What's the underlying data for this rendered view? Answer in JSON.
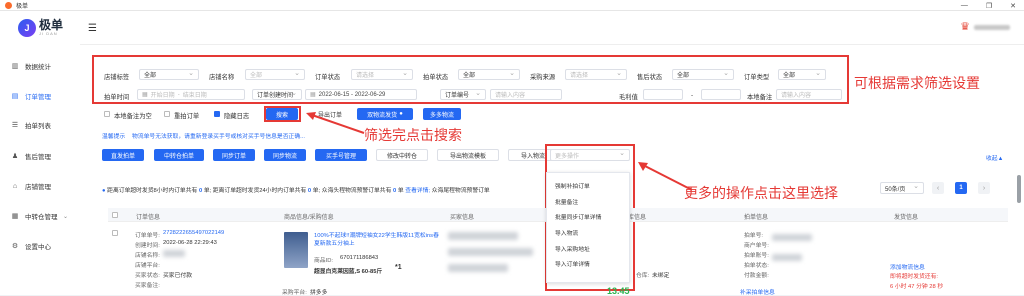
{
  "window": {
    "title": "极单"
  },
  "brand": {
    "name": "极单",
    "sub": "JI DAN"
  },
  "sidebar": {
    "items": [
      {
        "label": "数据统计",
        "icon": "bar-chart-icon"
      },
      {
        "label": "订单管理",
        "icon": "document-icon",
        "active": true
      },
      {
        "label": "拍单列表",
        "icon": "list-icon"
      },
      {
        "label": "售后管理",
        "icon": "service-icon"
      },
      {
        "label": "店铺管理",
        "icon": "shop-icon"
      },
      {
        "label": "中转仓管理",
        "icon": "warehouse-icon",
        "caret": "⌄"
      },
      {
        "label": "设置中心",
        "icon": "gear-icon"
      }
    ]
  },
  "filters": {
    "shop_tag": {
      "label": "店铺标签",
      "value": "全部"
    },
    "shop_name": {
      "label": "店铺名称",
      "value": "全部"
    },
    "order_status": {
      "label": "订单状态",
      "value": "请选择"
    },
    "purchase_status": {
      "label": "拍单状态",
      "value": "全部"
    },
    "purchase_source": {
      "label": "采购来源",
      "value": "请选择"
    },
    "aftersale_status": {
      "label": "售后状态",
      "value": "全部"
    },
    "order_type": {
      "label": "订单类型",
      "value": "全部"
    },
    "purchase_time": {
      "label": "拍单时间",
      "start_placeholder": "开始日期",
      "sep": "-",
      "end_placeholder": "结束日期"
    },
    "create_time": {
      "value": "订单创建时间",
      "range": "2022-06-15 - 2022-06-29"
    },
    "order_no": {
      "value": "订单编号",
      "placeholder": "请输入内容"
    },
    "gross_margin": {
      "label": "毛利值",
      "min_placeholder": "",
      "sep": "-",
      "max_placeholder": ""
    },
    "local_note": {
      "label": "本地备注",
      "placeholder": "请输入内容"
    }
  },
  "options": {
    "note_empty": "本地备注为空",
    "repeat_order": "重拍订单",
    "hide_log": "隐藏日志"
  },
  "actions": {
    "search": "搜索",
    "export": "导出订单",
    "dual_ship": "双物流发货",
    "dual_ship_badge": "●",
    "multi_logistics": "多多物流"
  },
  "notice": {
    "prefix": "温馨提示",
    "text": "物流单号无法获取，请重新登录买手号或核对买手号信息是否正确..."
  },
  "toolbar": {
    "direct_purchase": "直发拍单",
    "transit_purchase": "中转仓拍单",
    "sync_order": "同步订单",
    "sync_logistics": "同步物流",
    "buyer_manage": "买手号管理",
    "modify_transit": "修改中转仓",
    "export_template": "导出物流模板",
    "import_logistics": "导入物流",
    "more_ops": "更多操作",
    "collapse": "收起▲"
  },
  "more_menu": {
    "items": [
      "强制补拍订单",
      "批量备注",
      "批量同步订单详情",
      "导入物流",
      "导入采购地址",
      "导入订单详情"
    ]
  },
  "stats": {
    "text1": "距离订单超时发货8小时内订单共有",
    "c1": "0",
    "u1": "单;",
    "text2": "距离订单超时发货24小时内订单共有",
    "c2": "0",
    "u2": "单;",
    "text3": "众海头程物流预警订单共有",
    "c3": "0",
    "u3": "单",
    "link": "查看详情;",
    "text4": "众海尾程物流预警订单"
  },
  "pagination": {
    "page_size": "50条/页",
    "current": "1",
    "prev": "‹",
    "next": "›"
  },
  "table": {
    "headers": [
      "订单信息",
      "商品信息/采购信息",
      "买家信息",
      "仓库信息",
      "拍单信息",
      "发货信息"
    ]
  },
  "row": {
    "order_no_label": "订单单号:",
    "order_no": "2728222655497022149",
    "create_label": "创建时间:",
    "create_time": "2022-06-28 22:29:43",
    "shop_label": "店铺名称:",
    "shop_platform_label": "店铺平台:",
    "buyer_status_label": "买家状态:",
    "buyer_status": "买家已付款",
    "buyer_note_label": "买家备注:",
    "product_title": "100%不起球!!潮牌短袖女22学生韩版11宽松ins春夏新款五分袖上",
    "product_id_label": "商品ID:",
    "product_id": "670171186843",
    "product_spec": "超显白克莱因蓝,S 60-85斤",
    "product_qty": "*1",
    "purchase_platform_label": "采购平台:",
    "purchase_platform": "拼多多",
    "price": "13.45",
    "warehouse_label": "仓库:",
    "warehouse_value": "未绑定",
    "purchase_no_label": "拍单号:",
    "merchant_no_label": "商户单号:",
    "purchase_account_label": "拍单账号:",
    "purchase_status_label": "拍单状态:",
    "paid_label": "付款金额:",
    "add_logistics": "添加物流信息",
    "timeout_label": "即将超时发货还有:",
    "timeout_value": "6 小时 47 分钟 28 秒",
    "supplement": "补采拍单信息"
  },
  "annotations": {
    "filter_tip": "可根据需求筛选设置",
    "search_tip": "筛选完点击搜索",
    "more_tip": "更多的操作点击这里选择"
  },
  "colors": {
    "primary": "#2468f2",
    "annotation": "#e53935",
    "brand": "#fa6b2c"
  }
}
